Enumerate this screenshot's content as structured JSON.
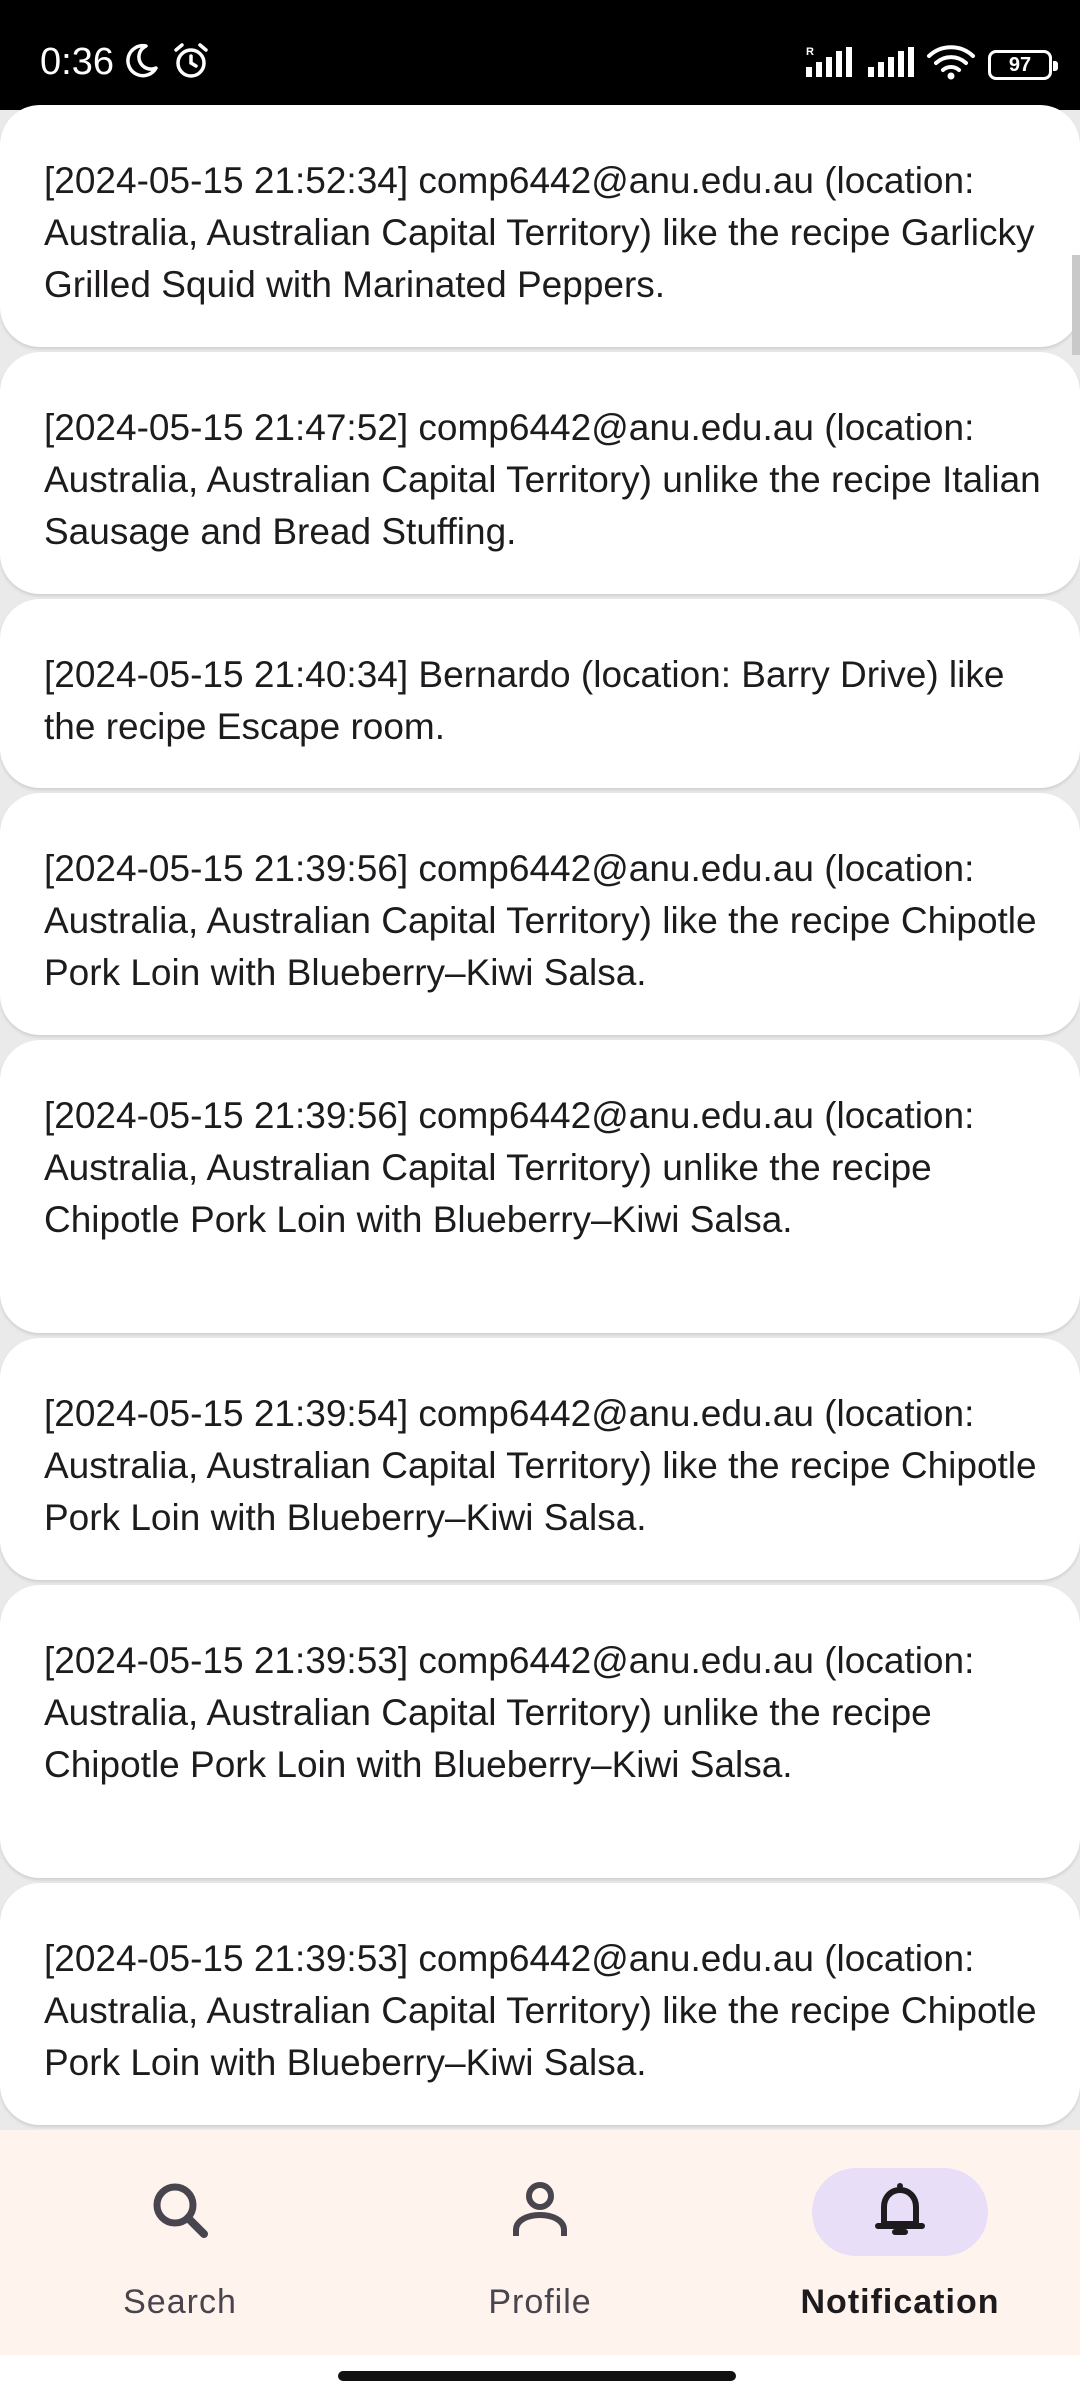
{
  "status_bar": {
    "time": "0:36",
    "battery": "97",
    "left_icons": [
      "moon-icon",
      "alarm-icon"
    ],
    "right_icons": [
      "signal-roaming-icon",
      "signal-icon",
      "wifi-icon",
      "battery-icon"
    ]
  },
  "notifications": [
    {
      "text": "[2024-05-15 21:52:34] comp6442@anu.edu.au (location: Australia, Australian Capital Territory) like the recipe Garlicky Grilled Squid with Marinated Peppers."
    },
    {
      "text": "[2024-05-15 21:47:52] comp6442@anu.edu.au (location: Australia, Australian Capital Territory) unlike the recipe Italian Sausage and Bread Stuffing."
    },
    {
      "text": "[2024-05-15 21:40:34] Bernardo (location: Barry Drive) like the recipe Escape room."
    },
    {
      "text": "[2024-05-15 21:39:56] comp6442@anu.edu.au (location: Australia, Australian Capital Territory) like the recipe Chipotle Pork Loin with Blueberry–Kiwi Salsa."
    },
    {
      "text": "[2024-05-15 21:39:56] comp6442@anu.edu.au (location: Australia, Australian Capital Territory) unlike the recipe Chipotle Pork Loin with Blueberry–Kiwi Salsa."
    },
    {
      "text": "[2024-05-15 21:39:54] comp6442@anu.edu.au (location: Australia, Australian Capital Territory) like the recipe Chipotle Pork Loin with Blueberry–Kiwi Salsa."
    },
    {
      "text": "[2024-05-15 21:39:53] comp6442@anu.edu.au (location: Australia, Australian Capital Territory) unlike the recipe Chipotle Pork Loin with Blueberry–Kiwi Salsa."
    },
    {
      "text": "[2024-05-15 21:39:53] comp6442@anu.edu.au (location: Australia, Australian Capital Territory) like the recipe Chipotle Pork Loin with Blueberry–Kiwi Salsa."
    }
  ],
  "bottom_nav": {
    "items": [
      {
        "label": "Search",
        "icon": "search-icon",
        "active": false
      },
      {
        "label": "Profile",
        "icon": "person-icon",
        "active": false
      },
      {
        "label": "Notification",
        "icon": "bell-icon",
        "active": true
      }
    ]
  },
  "colors": {
    "active_indicator": "#e8def8",
    "nav_background": "#fff3ee",
    "card_background": "#ffffff",
    "text": "#1d1b1e"
  }
}
